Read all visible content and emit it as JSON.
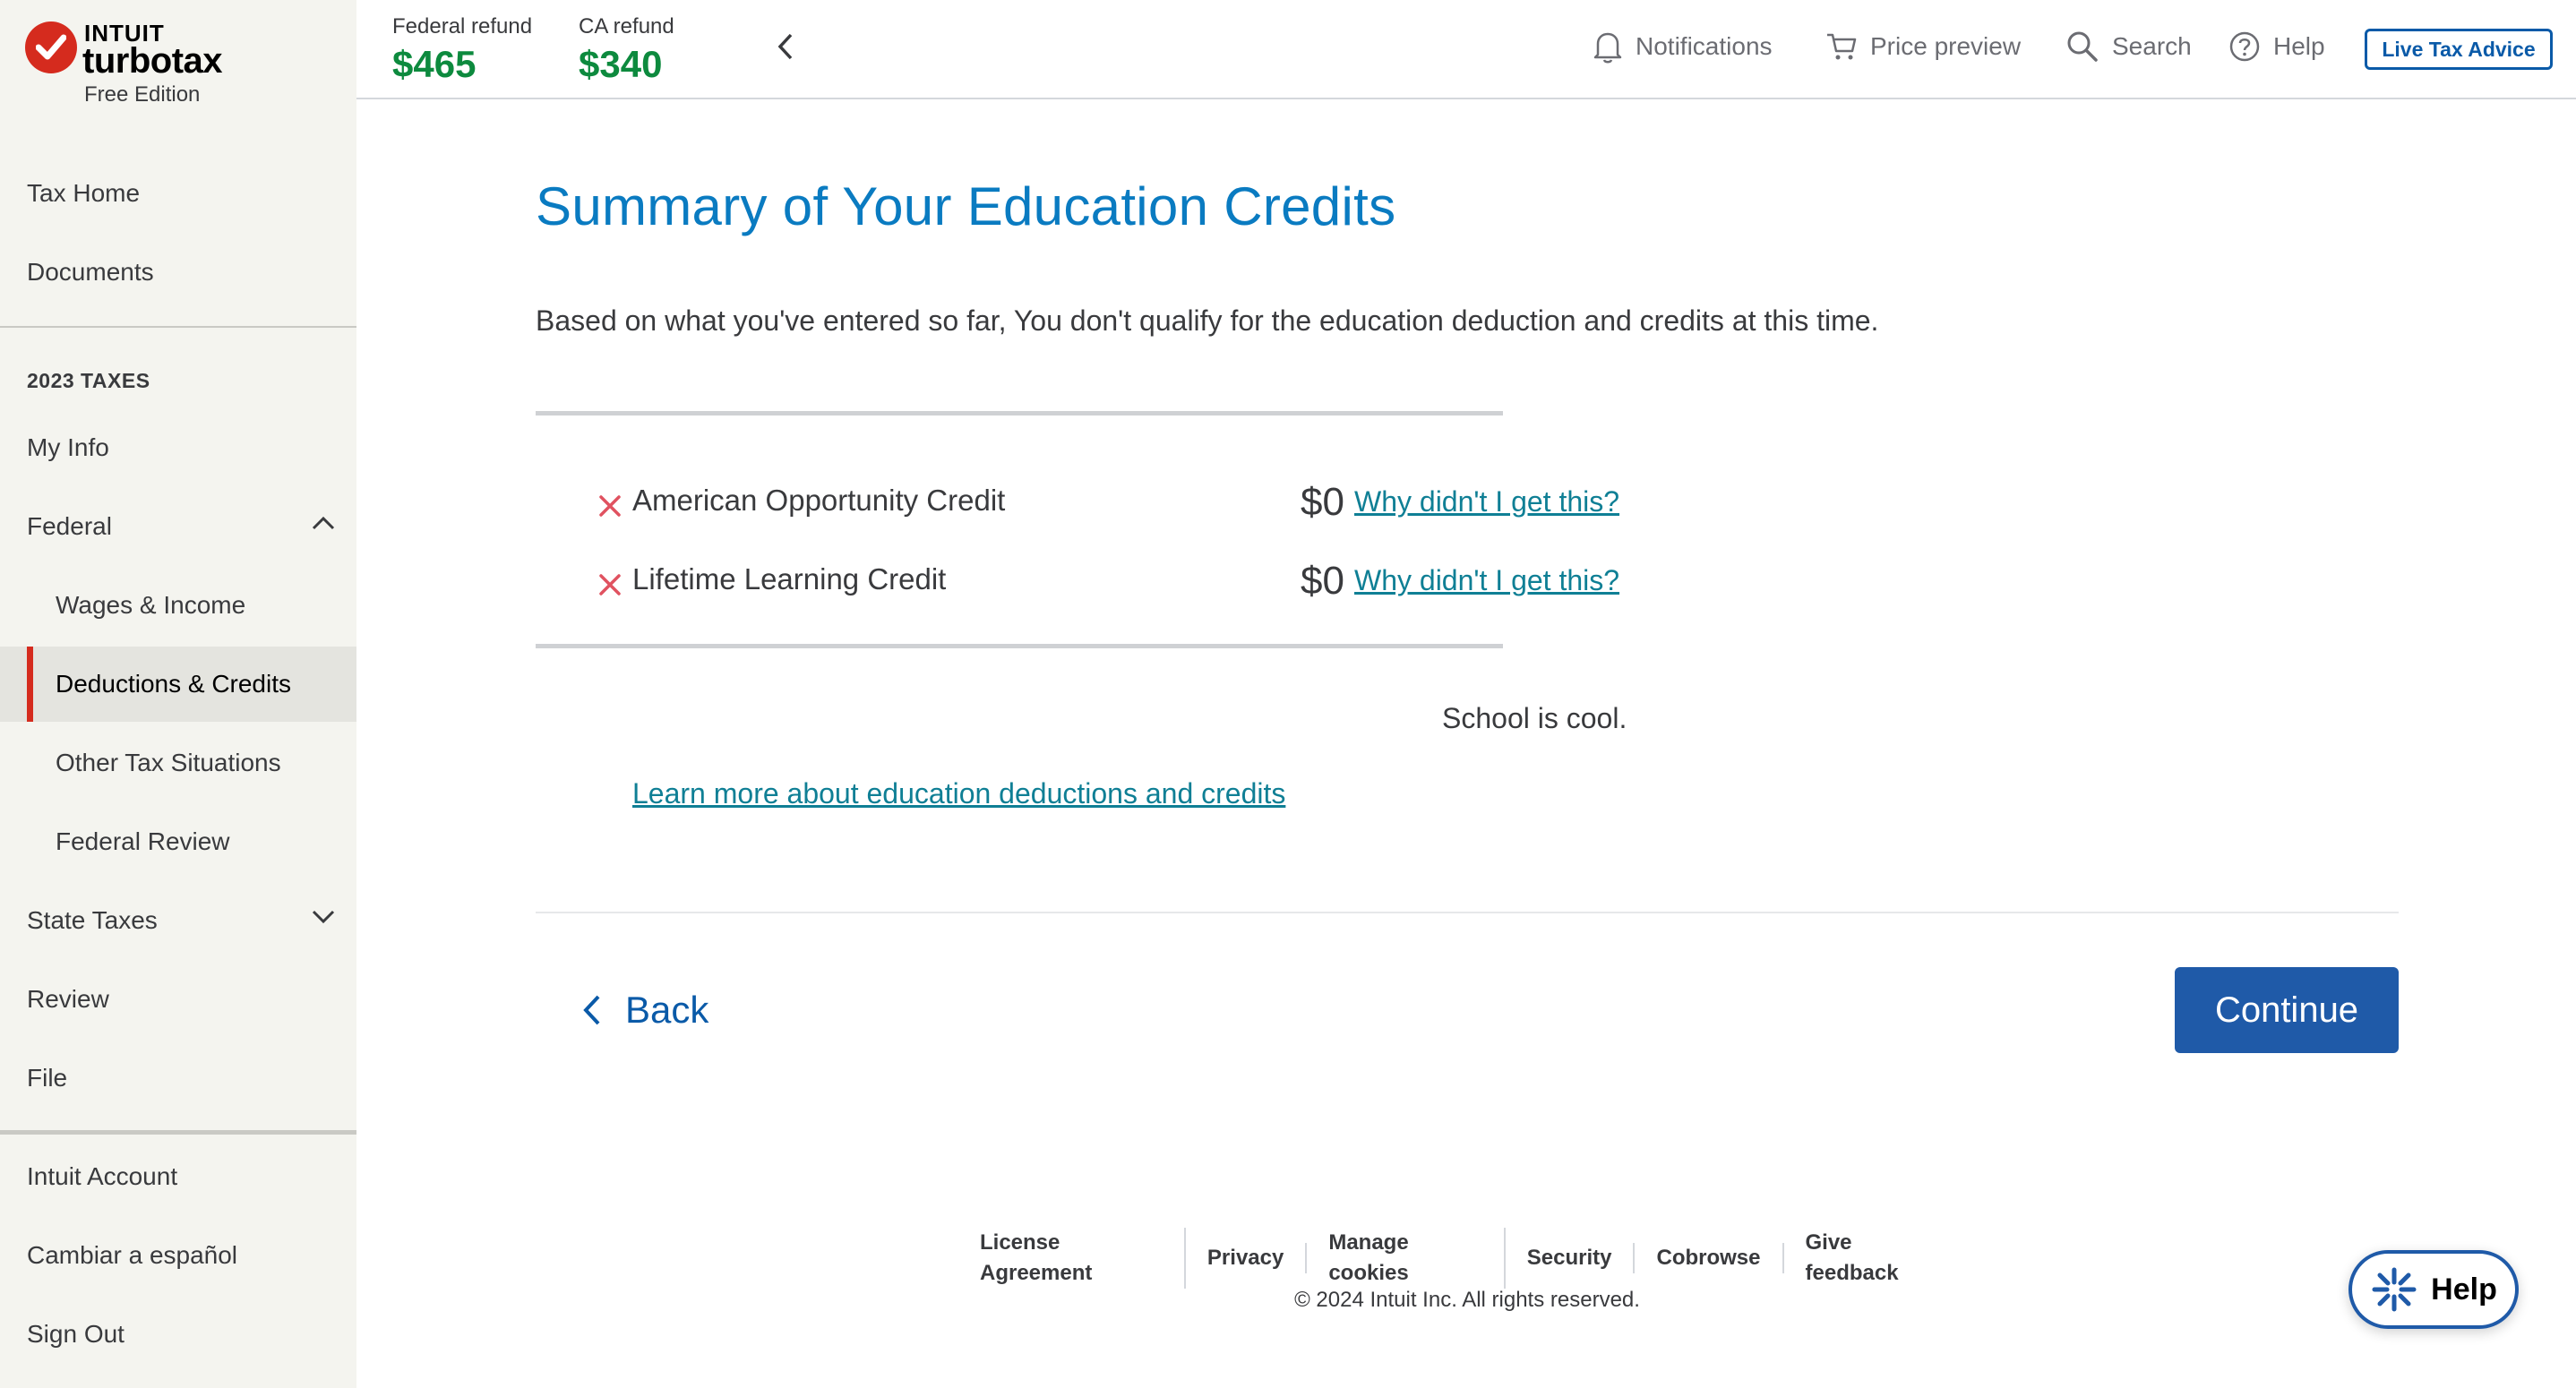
{
  "brand": {
    "company": "INTUIT",
    "product": "turbotax",
    "edition": "Free Edition",
    "accent_color": "#d52b1e"
  },
  "sidebar": {
    "top_items": [
      {
        "label": "Tax Home"
      },
      {
        "label": "Documents"
      }
    ],
    "section_title": "2023 TAXES",
    "tax_items": [
      {
        "label": "My Info"
      },
      {
        "label": "Federal",
        "expanded": true
      },
      {
        "label": "Wages & Income"
      },
      {
        "label": "Deductions & Credits",
        "active": true
      },
      {
        "label": "Other Tax Situations"
      },
      {
        "label": "Federal Review"
      },
      {
        "label": "State Taxes",
        "expanded": false
      },
      {
        "label": "Review"
      },
      {
        "label": "File"
      }
    ],
    "account_items": [
      {
        "label": "Intuit Account"
      },
      {
        "label": "Cambiar a español"
      },
      {
        "label": "Sign Out"
      }
    ]
  },
  "header": {
    "federal_refund_label": "Federal refund",
    "federal_refund_amount": "$465",
    "ca_refund_label": "CA refund",
    "ca_refund_amount": "$340",
    "notifications_label": "Notifications",
    "price_preview_label": "Price preview",
    "search_label": "Search",
    "help_label": "Help",
    "live_advice_label": "Live Tax Advice",
    "refund_color": "#0d8a3e"
  },
  "main": {
    "title": "Summary of Your Education Credits",
    "intro": "Based on what you've entered so far, You don't qualify for the education deduction and credits at this time.",
    "credits": [
      {
        "name": "American Opportunity Credit",
        "amount": "$0",
        "link": "Why didn't I get this?"
      },
      {
        "name": "Lifetime Learning Credit",
        "amount": "$0",
        "link": "Why didn't I get this?"
      }
    ],
    "note": "School is cool.",
    "learn_more": "Learn more about education deductions and credits",
    "back_label": "Back",
    "continue_label": "Continue"
  },
  "footer": {
    "links": [
      "License Agreement",
      "Privacy",
      "Manage cookies",
      "Security",
      "Cobrowse",
      "Give feedback"
    ],
    "copyright": "© 2024 Intuit Inc. All rights reserved.",
    "help_button": "Help"
  }
}
